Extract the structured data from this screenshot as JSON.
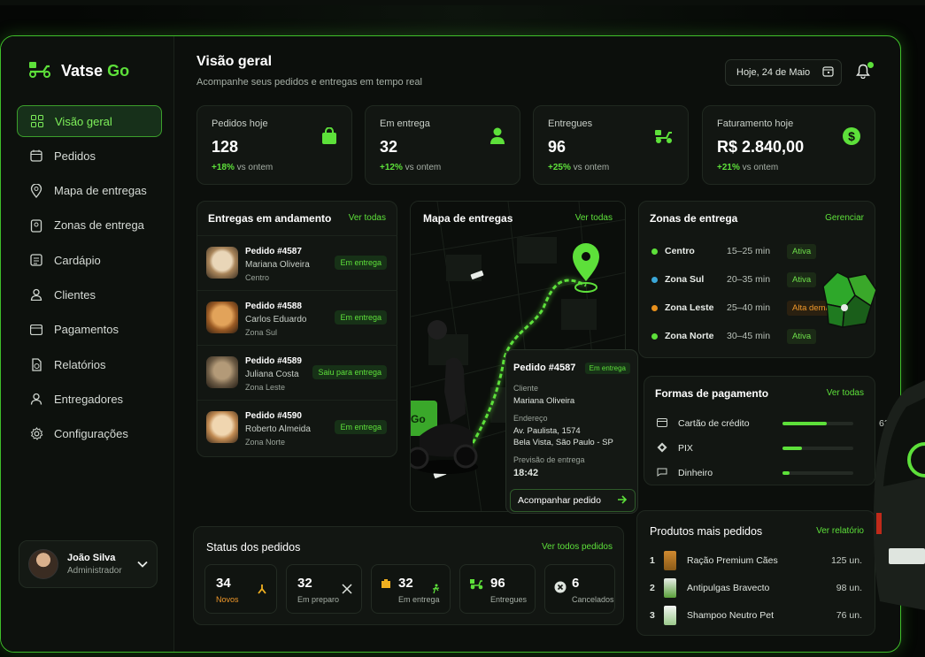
{
  "brand": {
    "name": "Vatse",
    "accent": "Go"
  },
  "nav": [
    {
      "label": "Visão geral",
      "icon": "grid-icon",
      "active": true
    },
    {
      "label": "Pedidos",
      "icon": "calendar-icon"
    },
    {
      "label": "Mapa de entregas",
      "icon": "map-pin-icon"
    },
    {
      "label": "Zonas de entrega",
      "icon": "zone-icon"
    },
    {
      "label": "Cardápio",
      "icon": "menu-icon"
    },
    {
      "label": "Clientes",
      "icon": "user-icon"
    },
    {
      "label": "Pagamentos",
      "icon": "card-icon"
    },
    {
      "label": "Relatórios",
      "icon": "report-icon"
    },
    {
      "label": "Entregadores",
      "icon": "courier-icon"
    },
    {
      "label": "Configurações",
      "icon": "gear-icon"
    }
  ],
  "user": {
    "name": "João Silva",
    "role": "Administrador"
  },
  "header": {
    "title": "Visão geral",
    "subtitle": "Acompanhe seus pedidos e entregas em tempo real",
    "date": "Hoje, 24 de Maio"
  },
  "stats": [
    {
      "label": "Pedidos hoje",
      "value": "128",
      "delta": "+18%",
      "suffix": "vs ontem",
      "icon": "bag-icon"
    },
    {
      "label": "Em entrega",
      "value": "32",
      "delta": "+12%",
      "suffix": "vs ontem",
      "icon": "person-icon"
    },
    {
      "label": "Entregues",
      "value": "96",
      "delta": "+25%",
      "suffix": "vs ontem",
      "icon": "scooter-icon"
    },
    {
      "label": "Faturamento hoje",
      "value": "R$ 2.840,00",
      "delta": "+21%",
      "suffix": "vs ontem",
      "icon": "dollar-icon"
    }
  ],
  "deliveries": {
    "title": "Entregas em andamento",
    "link": "Ver todas",
    "items": [
      {
        "order": "Pedido #4587",
        "name": "Mariana Oliveira",
        "zone": "Centro",
        "status": "Em entrega",
        "pet": "dog"
      },
      {
        "order": "Pedido #4588",
        "name": "Carlos Eduardo",
        "zone": "Zona Sul",
        "status": "Em entrega",
        "pet": "dog"
      },
      {
        "order": "Pedido #4589",
        "name": "Juliana Costa",
        "zone": "Zona Leste",
        "status": "Saiu para entrega",
        "pet": "cat"
      },
      {
        "order": "Pedido #4590",
        "name": "Roberto Almeida",
        "zone": "Zona Norte",
        "status": "Em entrega",
        "pet": "dog"
      }
    ]
  },
  "map": {
    "title": "Mapa de entregas",
    "link": "Ver todas"
  },
  "popup": {
    "order": "Pedido #4587",
    "status": "Em entrega",
    "client_label": "Cliente",
    "client": "Mariana Oliveira",
    "address_label": "Endereço",
    "address1": "Av. Paulista, 1574",
    "address2": "Bela Vista, São Paulo - SP",
    "eta_label": "Previsão de entrega",
    "eta": "18:42",
    "button": "Acompanhar pedido"
  },
  "zones": {
    "title": "Zonas de entrega",
    "link": "Gerenciar",
    "items": [
      {
        "name": "Centro",
        "time": "15–25 min",
        "status": "Ativa",
        "color": "#5de03a",
        "status_color": "#6ee04a"
      },
      {
        "name": "Zona Sul",
        "time": "20–35 min",
        "status": "Ativa",
        "color": "#3aa7d8",
        "status_color": "#6ee04a"
      },
      {
        "name": "Zona Leste",
        "time": "25–40 min",
        "status": "Alta demanda",
        "color": "#e8901c",
        "status_color": "#f0982a"
      },
      {
        "name": "Zona Norte",
        "time": "30–45 min",
        "status": "Ativa",
        "color": "#5de03a",
        "status_color": "#6ee04a"
      }
    ]
  },
  "payments": {
    "title": "Formas de pagamento",
    "link": "Ver todas",
    "items": [
      {
        "name": "Cartão de crédito",
        "pct": "62%",
        "value": 62,
        "icon": "credit-card-icon"
      },
      {
        "name": "PIX",
        "pct": "28%",
        "value": 28,
        "icon": "pix-icon"
      },
      {
        "name": "Dinheiro",
        "pct": "10%",
        "value": 10,
        "icon": "cash-icon"
      }
    ]
  },
  "status": {
    "title": "Status dos pedidos",
    "link": "Ver todos pedidos",
    "items": [
      {
        "value": "34",
        "label": "Novos",
        "icon": "new-icon",
        "label_color": "#f0982a"
      },
      {
        "value": "32",
        "label": "Em preparo",
        "icon": "utensils-icon",
        "label_color": "#a6afa6"
      },
      {
        "value": "32",
        "label": "Em entrega",
        "icon": "package-icon",
        "label_color": "#a6afa6"
      },
      {
        "value": "96",
        "label": "Entregues",
        "icon": "scooter-icon",
        "label_color": "#a6afa6"
      },
      {
        "value": "6",
        "label": "Cancelados",
        "icon": "cancel-icon",
        "label_color": "#a6afa6"
      }
    ]
  },
  "products": {
    "title": "Produtos mais pedidos",
    "link": "Ver relatório",
    "items": [
      {
        "rank": "1",
        "name": "Ração Premium Cães",
        "qty": "125 un."
      },
      {
        "rank": "2",
        "name": "Antipulgas Bravecto",
        "qty": "98 un."
      },
      {
        "rank": "3",
        "name": "Shampoo Neutro Pet",
        "qty": "76 un."
      }
    ]
  },
  "colors": {
    "accent": "#5de03a",
    "background": "#0c0f0c",
    "card": "#121612"
  }
}
